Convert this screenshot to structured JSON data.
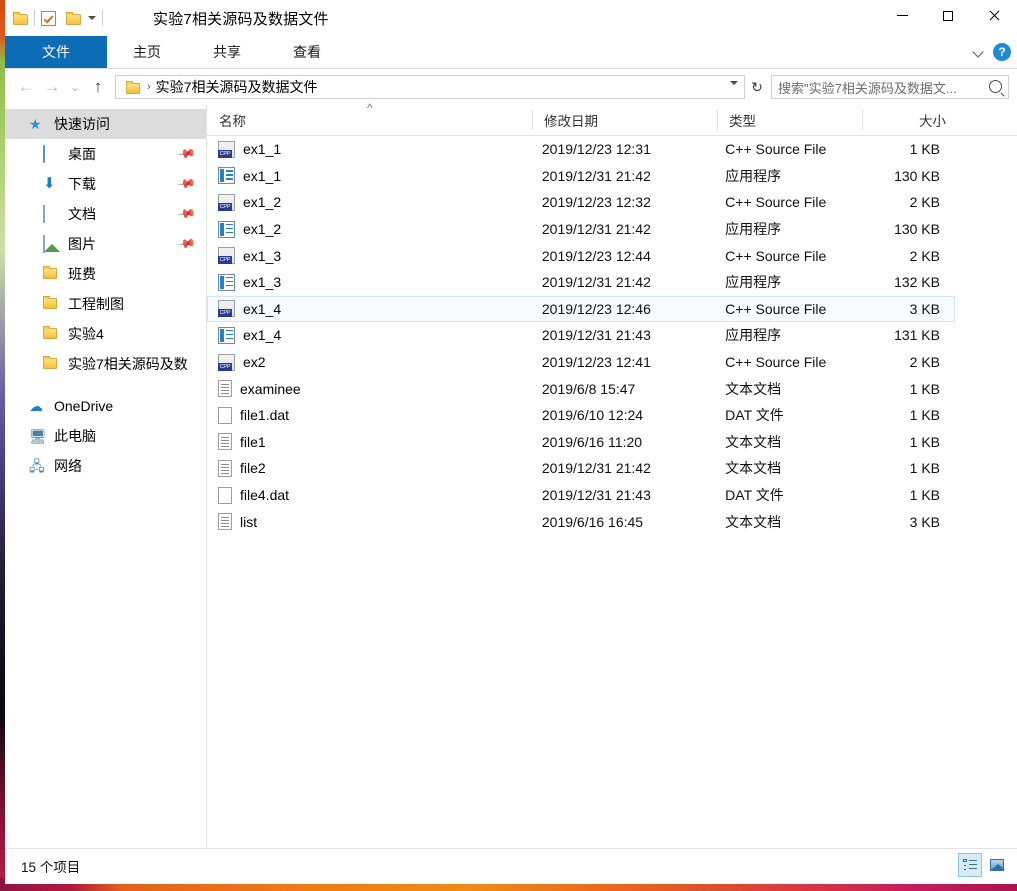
{
  "window": {
    "title": "实验7相关源码及数据文件",
    "quick_access": {
      "folder_icon": "folder-icon",
      "properties_icon": "checkbox-icon",
      "new_folder_icon": "folder-icon",
      "customize_icon": "chevron-down-icon"
    },
    "controls": {
      "minimize": "minimize-icon",
      "maximize": "maximize-icon",
      "close": "close-icon"
    }
  },
  "ribbon": {
    "tabs": [
      {
        "label": "文件",
        "active": true
      },
      {
        "label": "主页",
        "active": false
      },
      {
        "label": "共享",
        "active": false
      },
      {
        "label": "查看",
        "active": false
      }
    ],
    "expand_icon": "chevron-down-icon",
    "help_label": "?",
    "accent_color": "#0c6cb5"
  },
  "navigation": {
    "back_icon": "←",
    "forward_icon": "→",
    "recent_icon": "⌄",
    "up_icon": "↑",
    "refresh_icon": "↻",
    "breadcrumb": {
      "folder_icon": "folder-icon",
      "separator": "›",
      "path": "实验7相关源码及数据文件"
    },
    "search": {
      "placeholder": "搜索\"实验7相关源码及数据文...",
      "value": "",
      "icon": "search-icon"
    }
  },
  "sidebar": {
    "items": [
      {
        "label": "快速访问",
        "icon": "star-icon",
        "selected": true,
        "pinned": false,
        "level": "root"
      },
      {
        "label": "桌面",
        "icon": "desktop-icon",
        "selected": false,
        "pinned": true,
        "level": "child"
      },
      {
        "label": "下载",
        "icon": "download-icon",
        "selected": false,
        "pinned": true,
        "level": "child"
      },
      {
        "label": "文档",
        "icon": "documents-icon",
        "selected": false,
        "pinned": true,
        "level": "child"
      },
      {
        "label": "图片",
        "icon": "pictures-icon",
        "selected": false,
        "pinned": true,
        "level": "child"
      },
      {
        "label": "班费",
        "icon": "folder-icon",
        "selected": false,
        "pinned": false,
        "level": "child"
      },
      {
        "label": "工程制图",
        "icon": "folder-icon",
        "selected": false,
        "pinned": false,
        "level": "child"
      },
      {
        "label": "实验4",
        "icon": "folder-icon",
        "selected": false,
        "pinned": false,
        "level": "child"
      },
      {
        "label": "实验7相关源码及数",
        "icon": "folder-icon",
        "selected": false,
        "pinned": false,
        "level": "child"
      },
      {
        "label": "OneDrive",
        "icon": "cloud-icon",
        "selected": false,
        "pinned": false,
        "level": "root"
      },
      {
        "label": "此电脑",
        "icon": "this-pc-icon",
        "selected": false,
        "pinned": false,
        "level": "root"
      },
      {
        "label": "网络",
        "icon": "network-icon",
        "selected": false,
        "pinned": false,
        "level": "root"
      }
    ]
  },
  "filelist": {
    "columns": [
      {
        "label": "名称",
        "sorted": true,
        "sort_direction": "ascending",
        "sort_mark": "^"
      },
      {
        "label": "修改日期",
        "sorted": false
      },
      {
        "label": "类型",
        "sorted": false
      },
      {
        "label": "大小",
        "sorted": false
      }
    ],
    "rows": [
      {
        "name": "ex1_1",
        "date": "2019/12/23 12:31",
        "type": "C++ Source File",
        "size": "1 KB",
        "icon": "cpp-file-icon",
        "hovered": false
      },
      {
        "name": "ex1_1",
        "date": "2019/12/31 21:42",
        "type": "应用程序",
        "size": "130 KB",
        "icon": "exe-file-icon",
        "hovered": false
      },
      {
        "name": "ex1_2",
        "date": "2019/12/23 12:32",
        "type": "C++ Source File",
        "size": "2 KB",
        "icon": "cpp-file-icon",
        "hovered": false
      },
      {
        "name": "ex1_2",
        "date": "2019/12/31 21:42",
        "type": "应用程序",
        "size": "130 KB",
        "icon": "exe-file-icon",
        "hovered": false
      },
      {
        "name": "ex1_3",
        "date": "2019/12/23 12:44",
        "type": "C++ Source File",
        "size": "2 KB",
        "icon": "cpp-file-icon",
        "hovered": false
      },
      {
        "name": "ex1_3",
        "date": "2019/12/31 21:42",
        "type": "应用程序",
        "size": "132 KB",
        "icon": "exe-file-icon",
        "hovered": false
      },
      {
        "name": "ex1_4",
        "date": "2019/12/23 12:46",
        "type": "C++ Source File",
        "size": "3 KB",
        "icon": "cpp-file-icon",
        "hovered": true
      },
      {
        "name": "ex1_4",
        "date": "2019/12/31 21:43",
        "type": "应用程序",
        "size": "131 KB",
        "icon": "exe-file-icon",
        "hovered": false
      },
      {
        "name": "ex2",
        "date": "2019/12/23 12:41",
        "type": "C++ Source File",
        "size": "2 KB",
        "icon": "cpp-file-icon",
        "hovered": false
      },
      {
        "name": "examinee",
        "date": "2019/6/8 15:47",
        "type": "文本文档",
        "size": "1 KB",
        "icon": "text-file-icon",
        "hovered": false
      },
      {
        "name": "file1.dat",
        "date": "2019/6/10 12:24",
        "type": "DAT 文件",
        "size": "1 KB",
        "icon": "dat-file-icon",
        "hovered": false
      },
      {
        "name": "file1",
        "date": "2019/6/16 11:20",
        "type": "文本文档",
        "size": "1 KB",
        "icon": "text-file-icon",
        "hovered": false
      },
      {
        "name": "file2",
        "date": "2019/12/31 21:42",
        "type": "文本文档",
        "size": "1 KB",
        "icon": "text-file-icon",
        "hovered": false
      },
      {
        "name": "file4.dat",
        "date": "2019/12/31 21:43",
        "type": "DAT 文件",
        "size": "1 KB",
        "icon": "dat-file-icon",
        "hovered": false
      },
      {
        "name": "list",
        "date": "2019/6/16 16:45",
        "type": "文本文档",
        "size": "3 KB",
        "icon": "text-file-icon",
        "hovered": false
      }
    ]
  },
  "statusbar": {
    "item_count_text": "15 个项目",
    "views": [
      {
        "name": "details-view",
        "active": true
      },
      {
        "name": "large-icons-view",
        "active": false
      }
    ]
  }
}
